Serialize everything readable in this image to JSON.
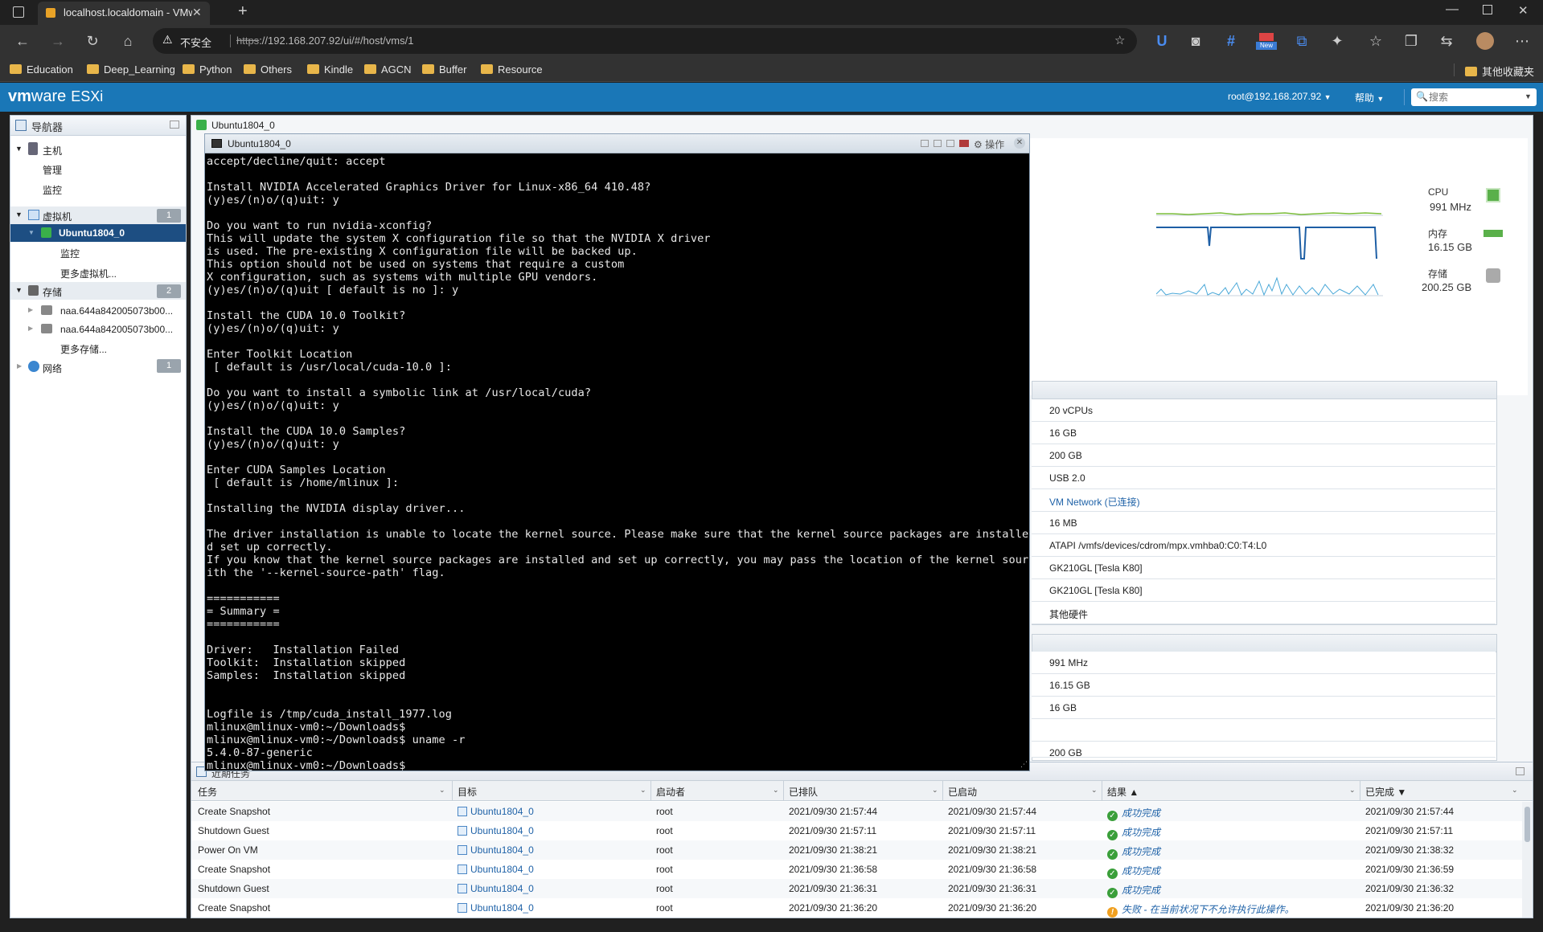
{
  "browser": {
    "tab_title": "localhost.localdomain - VMware",
    "security_label": "不安全",
    "url_scheme": "https",
    "url_rest": "://192.168.207.92/ui/#/host/vms/1",
    "bookmarks": [
      "Education",
      "Deep_Learning",
      "Python",
      "Others",
      "Kindle",
      "AGCN",
      "Buffer",
      "Resource"
    ],
    "other_bookmarks": "其他收藏夹",
    "new_badge": "New"
  },
  "esxi": {
    "logo_vm": "vm",
    "logo_ware": "ware",
    "logo_product": "ESXi",
    "user": "root@192.168.207.92",
    "help": "帮助",
    "search_placeholder": "搜索"
  },
  "navigator": {
    "title": "导航器",
    "host": "主机",
    "host_manage": "管理",
    "host_monitor": "监控",
    "vms": "虚拟机",
    "vms_count": "1",
    "vm_selected": "Ubuntu1804_0",
    "vm_monitor": "监控",
    "more_vms": "更多虚拟机...",
    "storage": "存储",
    "storage_count": "2",
    "storage_items": [
      "naa.644a842005073b00...",
      "naa.644a842005073b00..."
    ],
    "more_storage": "更多存储...",
    "network": "网络",
    "network_count": "1"
  },
  "main": {
    "tab_title": "Ubuntu1804_0",
    "stats": {
      "cpu_label": "CPU",
      "cpu_value": "991 MHz",
      "mem_label": "内存",
      "mem_value": "16.15 GB",
      "storage_label": "存储",
      "storage_value": "200.25 GB"
    },
    "hardware": [
      "20 vCPUs",
      "16 GB",
      "200 GB",
      "USB 2.0",
      "VM Network (已连接)",
      "16 MB",
      "ATAPI /vmfs/devices/cdrom/mpx.vmhba0:C0:T4:L0",
      "GK210GL [Tesla K80]",
      "GK210GL [Tesla K80]",
      "其他硬件"
    ],
    "usage": [
      "991 MHz",
      "16.15 GB",
      "16 GB",
      "",
      "200 GB"
    ]
  },
  "console": {
    "title": "Ubuntu1804_0",
    "actions_label": "操作",
    "text": "accept/decline/quit: accept\n\nInstall NVIDIA Accelerated Graphics Driver for Linux-x86_64 410.48?\n(y)es/(n)o/(q)uit: y\n\nDo you want to run nvidia-xconfig?\nThis will update the system X configuration file so that the NVIDIA X driver\nis used. The pre-existing X configuration file will be backed up.\nThis option should not be used on systems that require a custom\nX configuration, such as systems with multiple GPU vendors.\n(y)es/(n)o/(q)uit [ default is no ]: y\n\nInstall the CUDA 10.0 Toolkit?\n(y)es/(n)o/(q)uit: y\n\nEnter Toolkit Location\n [ default is /usr/local/cuda-10.0 ]:\n\nDo you want to install a symbolic link at /usr/local/cuda?\n(y)es/(n)o/(q)uit: y\n\nInstall the CUDA 10.0 Samples?\n(y)es/(n)o/(q)uit: y\n\nEnter CUDA Samples Location\n [ default is /home/mlinux ]:\n\nInstalling the NVIDIA display driver...\n\nThe driver installation is unable to locate the kernel source. Please make sure that the kernel source packages are installed an\nd set up correctly.\nIf you know that the kernel source packages are installed and set up correctly, you may pass the location of the kernel source w\nith the '--kernel-source-path' flag.\n\n===========\n= Summary =\n===========\n\nDriver:   Installation Failed\nToolkit:  Installation skipped\nSamples:  Installation skipped\n\n\nLogfile is /tmp/cuda_install_1977.log\nmlinux@mlinux-vm0:~/Downloads$\nmlinux@mlinux-vm0:~/Downloads$ uname -r\n5.4.0-87-generic\nmlinux@mlinux-vm0:~/Downloads$"
  },
  "tasks": {
    "title": "近期任务",
    "columns": [
      "任务",
      "目标",
      "启动者",
      "已排队",
      "已启动",
      "结果 ▲",
      "已完成 ▼"
    ],
    "rows": [
      {
        "task": "Create Snapshot",
        "target": "Ubuntu1804_0",
        "initiator": "root",
        "queued": "2021/09/30 21:57:44",
        "started": "2021/09/30 21:57:44",
        "result": "成功完成",
        "completed": "2021/09/30 21:57:44",
        "ok": true
      },
      {
        "task": "Shutdown Guest",
        "target": "Ubuntu1804_0",
        "initiator": "root",
        "queued": "2021/09/30 21:57:11",
        "started": "2021/09/30 21:57:11",
        "result": "成功完成",
        "completed": "2021/09/30 21:57:11",
        "ok": true
      },
      {
        "task": "Power On VM",
        "target": "Ubuntu1804_0",
        "initiator": "root",
        "queued": "2021/09/30 21:38:21",
        "started": "2021/09/30 21:38:21",
        "result": "成功完成",
        "completed": "2021/09/30 21:38:32",
        "ok": true
      },
      {
        "task": "Create Snapshot",
        "target": "Ubuntu1804_0",
        "initiator": "root",
        "queued": "2021/09/30 21:36:58",
        "started": "2021/09/30 21:36:58",
        "result": "成功完成",
        "completed": "2021/09/30 21:36:59",
        "ok": true
      },
      {
        "task": "Shutdown Guest",
        "target": "Ubuntu1804_0",
        "initiator": "root",
        "queued": "2021/09/30 21:36:31",
        "started": "2021/09/30 21:36:31",
        "result": "成功完成",
        "completed": "2021/09/30 21:36:32",
        "ok": true
      },
      {
        "task": "Create Snapshot",
        "target": "Ubuntu1804_0",
        "initiator": "root",
        "queued": "2021/09/30 21:36:20",
        "started": "2021/09/30 21:36:20",
        "result": "失败 - 在当前状况下不允许执行此操作。",
        "completed": "2021/09/30 21:36:20",
        "ok": false
      }
    ]
  },
  "colors": {
    "esxi_blue": "#1a77b7",
    "success": "#3a9f3a",
    "warning": "#f0a020"
  }
}
